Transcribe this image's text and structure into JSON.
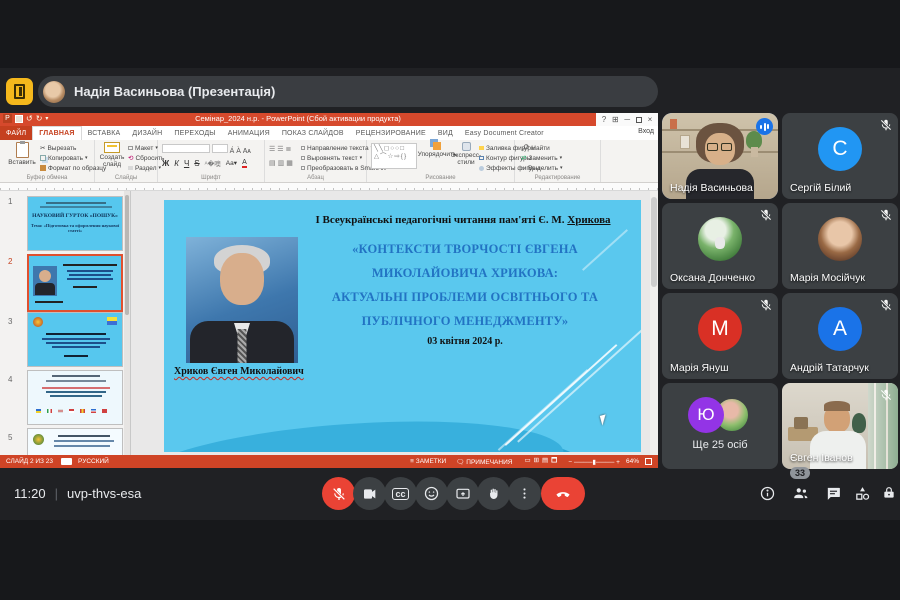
{
  "meet": {
    "presenter_banner": "Надія Васиньова (Презентація)",
    "time": "11:20",
    "meeting_code": "uvp-thvs-esa",
    "participants_count_badge": "33",
    "controls": {
      "cc_label": "cc"
    },
    "tiles": [
      {
        "name": "Надія Васиньова",
        "type": "video",
        "speaking": true
      },
      {
        "name": "Сергій Білий",
        "initial": "С",
        "muted": true
      },
      {
        "name": "Оксана Донченко",
        "muted": true
      },
      {
        "name": "Марія Мосійчук",
        "muted": true
      },
      {
        "name": "Марія Януш",
        "initial": "М",
        "muted": true
      },
      {
        "name": "Андрій Татарчук",
        "initial": "А",
        "muted": true
      },
      {
        "name": "Ще 25 осіб",
        "initial": "Ю",
        "overflow": true
      },
      {
        "name": "Євген Іванов",
        "type": "video",
        "muted": true
      }
    ],
    "colors": {
      "background": "#202124",
      "tile": "#3c4043",
      "speaking_border": "#7faef8",
      "audio_indicator": "#1a73e8",
      "danger": "#ea4335",
      "avatar_blue": "#2196f3",
      "avatar_dark_blue": "#1a73e8",
      "avatar_red": "#d93025",
      "avatar_purple": "#9334e6"
    }
  },
  "powerpoint": {
    "title": "Семінар_2024 н.р. - PowerPoint (Сбой активации продукта)",
    "sign_in": "Вход",
    "tabs": [
      "ФАЙЛ",
      "ГЛАВНАЯ",
      "ВСТАВКА",
      "ДИЗАЙН",
      "ПЕРЕХОДЫ",
      "АНИМАЦИЯ",
      "ПОКАЗ СЛАЙДОВ",
      "РЕЦЕНЗИРОВАНИЕ",
      "ВИД",
      "Easy Document Creator"
    ],
    "ribbon": {
      "clipboard": {
        "paste": "Вставить",
        "cut": "Вырезать",
        "copy": "Копировать",
        "format_painter": "Формат по образцу",
        "group": "Буфер обмена"
      },
      "slides": {
        "new_slide": "Создать слайд",
        "layout": "Макет",
        "reset": "Сбросить",
        "section": "Раздел",
        "group": "Слайды"
      },
      "font": {
        "bold": "Ж",
        "italic": "К",
        "underline": "Ч",
        "strike": "S",
        "group": "Шрифт"
      },
      "paragraph": {
        "text_direction": "Направление текста",
        "align_text": "Выровнять текст",
        "smartart": "Преобразовать в SmartArt",
        "group": "Абзац"
      },
      "drawing": {
        "arrange": "Упорядочить",
        "quick_styles": "Экспресс-стили",
        "shape_fill": "Заливка фигуры",
        "shape_outline": "Контур фигуры",
        "shape_effects": "Эффекты фигуры",
        "group": "Рисование"
      },
      "editing": {
        "find": "Найти",
        "replace": "Заменить",
        "select": "Выделить",
        "group": "Редактирование"
      }
    },
    "thumbnails": [
      {
        "num": "1",
        "line1": "НАУКОВИЙ ГУРТОК «ПОШУК»",
        "line2": "Тема: «Підготовка та оформлення наукової статті»"
      },
      {
        "num": "2"
      },
      {
        "num": "3"
      },
      {
        "num": "4"
      },
      {
        "num": "5"
      }
    ],
    "slide": {
      "heading_prefix": "І Всеукраїнські педагогічні читання пам'яті Є. М. ",
      "heading_name": "Хрикова",
      "title_lines": [
        "«КОНТЕКСТИ ТВОРЧОСТІ ЄВГЕНА",
        "МИКОЛАЙОВИЧА ХРИКОВА:",
        "АКТУАЛЬНІ ПРОБЛЕМИ ОСВІТНЬОГО ТА",
        "ПУБЛІЧНОГО МЕНЕДЖМЕНТУ»"
      ],
      "date": "03 квітня 2024 р.",
      "photo_caption": "Хриков Євген Миколайович",
      "colors": {
        "background": "#5ac8ee",
        "title_text": "#2273c3"
      }
    },
    "status_bar": {
      "slide_indicator": "СЛАЙД 2 ИЗ 23",
      "language": "РУССКИЙ",
      "notes": "ЗАМЕТКИ",
      "comments": "ПРИМЕЧАНИЯ",
      "zoom": "64%"
    },
    "colors": {
      "chrome_red": "#d6492c",
      "tab_selected_text": "#c5401f"
    }
  }
}
